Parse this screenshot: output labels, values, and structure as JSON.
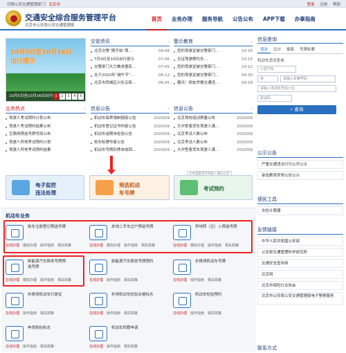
{
  "topbar": {
    "switch_label": "切换公安交通管理部门：",
    "city": "北京市",
    "login": "个人用户登录",
    "register": "注册",
    "help": "帮助",
    "login_red": "登录"
  },
  "header": {
    "title": "交通安全综合服务管理平台",
    "subtitle": "北京市公安局公安交通管理局"
  },
  "nav": [
    "首页",
    "业务办理",
    "服务导航",
    "公告公布",
    "APP下载",
    "办事指南"
  ],
  "banner": {
    "line1": "10月5日至10月16日",
    "line2": "出行提示",
    "caption": "10月5日至10月16日出行提示",
    "pages": [
      "1",
      "2",
      "3",
      "4",
      "5"
    ]
  },
  "traffic_news": {
    "title": "交管资讯",
    "more": "›",
    "items": [
      {
        "t": "北京交警“随手拍”首…",
        "d": "09-08"
      },
      {
        "t": "7月4日至10日出行提示",
        "d": "07-06"
      },
      {
        "t": "交警部门大力推进便民…",
        "d": "07-05"
      },
      {
        "t": "关于2020年“端午节”…",
        "d": "06-12"
      },
      {
        "t": "北京市西城区兴化五街…",
        "d": "06-05"
      }
    ]
  },
  "safety_ed": {
    "title": "警示教育",
    "more": "›",
    "items": [
      {
        "t": "您的驾驶证被交警部门…",
        "d": "10-16"
      },
      {
        "t": "无证驾驶摩托车…",
        "d": "10-15"
      },
      {
        "t": "您的驾驶证被交警部门…",
        "d": "10-12"
      },
      {
        "t": "您的驾驶证被交警部门…",
        "d": "09-30"
      },
      {
        "t": "曝光！网友举报交通违…",
        "d": "09-18"
      }
    ]
  },
  "hot": {
    "title": "业务热点",
    "more": "›",
    "items": [
      "驾驶人考试预约计划公布",
      "驾驶人考试预约结果公布",
      "互联网预选号牌号段公布",
      "驾驶人异地考试预约计划",
      "驾驶人异地考试预约结果"
    ]
  },
  "info_pub": {
    "title": "信息公告",
    "more": "›",
    "items": [
      {
        "t": "机动车临界强制报废公告",
        "d": "2020/09"
      },
      {
        "t": "机动车登记证书作废公告",
        "d": "2020/09"
      },
      {
        "t": "机动车逾期未检验公告",
        "d": "2020/09"
      },
      {
        "t": "校车标牌作废公告",
        "d": "2020/09"
      },
      {
        "t": "机动车号牌旧拷未收回…",
        "d": "2020/09"
      }
    ]
  },
  "info_pub2": {
    "title": "信息公告",
    "more": "›",
    "items": [
      {
        "t": "北京驾校培训质量公布",
        "d": "2020/09"
      },
      {
        "t": "大中型客货车驾驶人满…",
        "d": "2020/09"
      },
      {
        "t": "北京考试人数公布",
        "d": "2020/09"
      },
      {
        "t": "北京考试人数公布",
        "d": "2020/09"
      },
      {
        "t": "大中型客货车驾驶人满…",
        "d": "2020/09"
      }
    ]
  },
  "tooltip": "大中型客货车驾驶人满分公告",
  "services": [
    {
      "label1": "电子监控",
      "label2": "违法处理",
      "color": "#1d3e78",
      "bg": "#e6f0fa",
      "icon": "#5aa6e0"
    },
    {
      "label1": "预选机动",
      "label2": "车号牌",
      "color": "#c05a14",
      "bg": "#fdf1e4",
      "icon": "#f5a04a"
    },
    {
      "label1": "考试预约",
      "label2": "",
      "color": "#256b3a",
      "bg": "#e8f5ea",
      "icon": "#5cbf74"
    }
  ],
  "biz": {
    "title": "机动车业务",
    "cards": [
      {
        "name": "新车注册登记预选号牌",
        "links": [
          "在线办理",
          "模拟办理",
          "操作指南",
          "相关政策"
        ]
      },
      {
        "name": "本地二手车过户预选号牌",
        "links": [
          "在线办理",
          "模拟办理",
          "操作指南",
          "相关政策"
        ]
      },
      {
        "name": "异地转（迁）入预选号牌",
        "links": [
          "在线办理",
          "模拟办理",
          "操作指南",
          "相关政策"
        ]
      },
      {
        "name": "新能源汽车换发号牌预选号牌",
        "links": [
          "在线办理",
          "模拟办理",
          "操作指南",
          "相关政策"
        ]
      },
      {
        "name": "新能源汽车换发号牌预约",
        "links": [
          "在线办理",
          "操作指南",
          "相关政策"
        ]
      },
      {
        "name": "补换领机动车号牌",
        "links": [
          "在线办理",
          "操作指南",
          "相关政策"
        ]
      },
      {
        "name": "补换领机动车行驶证",
        "links": [
          "在线办理",
          "操作指南",
          "相关政策"
        ]
      },
      {
        "name": "补领机动车检验合格标志",
        "links": [
          "在线办理",
          "操作指南",
          "相关政策"
        ]
      },
      {
        "name": "机动车检验预约",
        "links": [
          "在线办理",
          "操作指南",
          "相关政策"
        ]
      },
      {
        "name": "申领免检标志",
        "links": [
          "在线办理",
          "操作指南",
          "相关政策"
        ]
      },
      {
        "name": "机动车转籍申请",
        "links": [
          "在线办理",
          "操作指南",
          "相关政策"
        ]
      }
    ]
  },
  "query": {
    "title": "信息查询",
    "tabs": [
      "违法",
      "记分",
      "报废",
      "号牌标要"
    ],
    "label": "机动车违法查询",
    "type": "小型汽车",
    "prefix": "京",
    "plate_ph": "请输入车辆号码",
    "vin_ph": "请输入发动机号后六位",
    "code_ph": "验证码",
    "button": "查询"
  },
  "public": {
    "title": "公示公告",
    "items": [
      "严重交通违法行为公开公示",
      "审验教育异常公告公示"
    ]
  },
  "tools": {
    "title": "便民工具",
    "items": [
      "车检计算器"
    ]
  },
  "links": {
    "title": "友情链接",
    "items": [
      "中华人民共和国公安部",
      "公安部交通管理科学研究所",
      "交通安全宣传网",
      "北京网",
      "北京市保险行业协会",
      "北京市公安局公安交通管理局电子警察服务"
    ]
  },
  "contact": {
    "title": "联系方式"
  }
}
